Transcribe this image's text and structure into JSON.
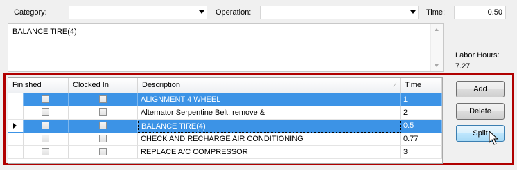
{
  "form": {
    "category_label": "Category:",
    "category_value": "",
    "operation_label": "Operation:",
    "operation_value": "",
    "time_label": "Time:",
    "time_value": "0.50",
    "notes": "BALANCE TIRE(4)",
    "labor_hours_label": "Labor Hours:",
    "labor_hours_value": "7.27"
  },
  "grid": {
    "columns": [
      "Finished",
      "Clocked In",
      "Description",
      "Time"
    ],
    "rows": [
      {
        "description": "ALIGNMENT 4 WHEEL",
        "time": "1",
        "selected": true
      },
      {
        "description": "Alternator Serpentine Belt: remove &",
        "time": "2",
        "selected": false
      },
      {
        "description": "BALANCE TIRE(4)",
        "time": "0.5",
        "selected": true,
        "current": true
      },
      {
        "description": "CHECK AND RECHARGE AIR CONDITIONING",
        "time": "0.77",
        "selected": false
      },
      {
        "description": "REPLACE A/C COMPRESSOR",
        "time": "3",
        "selected": false
      }
    ]
  },
  "buttons": {
    "add": "Add",
    "delete": "Delete",
    "split": "Split"
  },
  "colors": {
    "selection": "#3c93e6",
    "highlight_frame": "#b00000"
  }
}
